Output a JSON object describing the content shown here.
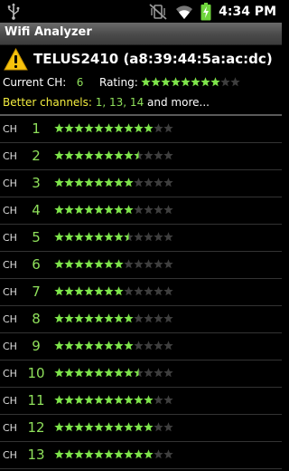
{
  "status_bar": {
    "time": "4:34 PM",
    "icons": [
      "usb-icon",
      "vibrate-mute-icon",
      "wifi-icon",
      "battery-charging-icon"
    ]
  },
  "app": {
    "title": "Wifi Analyzer"
  },
  "connection": {
    "ssid_line": "TELUS2410 (a8:39:44:5a:ac:dc)",
    "current_ch_label": "Current CH:",
    "current_ch_value": "6",
    "rating_label": "Rating:",
    "rating_stars": 8,
    "rating_max": 10,
    "better_label": "Better channels:",
    "better_channels": "1, 13, 14",
    "better_more": "and more..."
  },
  "colors": {
    "star_full": "#7ee54a",
    "star_empty": "#3e3e3e",
    "channel_number": "#8fe05b",
    "better_label": "#f4ee3f"
  },
  "channels": [
    {
      "label": "CH",
      "number": "1",
      "rating": 10
    },
    {
      "label": "CH",
      "number": "2",
      "rating": 8.5
    },
    {
      "label": "CH",
      "number": "3",
      "rating": 8
    },
    {
      "label": "CH",
      "number": "4",
      "rating": 8
    },
    {
      "label": "CH",
      "number": "5",
      "rating": 7.5
    },
    {
      "label": "CH",
      "number": "6",
      "rating": 7
    },
    {
      "label": "CH",
      "number": "7",
      "rating": 7
    },
    {
      "label": "CH",
      "number": "8",
      "rating": 8
    },
    {
      "label": "CH",
      "number": "9",
      "rating": 8
    },
    {
      "label": "CH",
      "number": "10",
      "rating": 8.5
    },
    {
      "label": "CH",
      "number": "11",
      "rating": 10
    },
    {
      "label": "CH",
      "number": "12",
      "rating": 10
    },
    {
      "label": "CH",
      "number": "13",
      "rating": 10
    }
  ]
}
